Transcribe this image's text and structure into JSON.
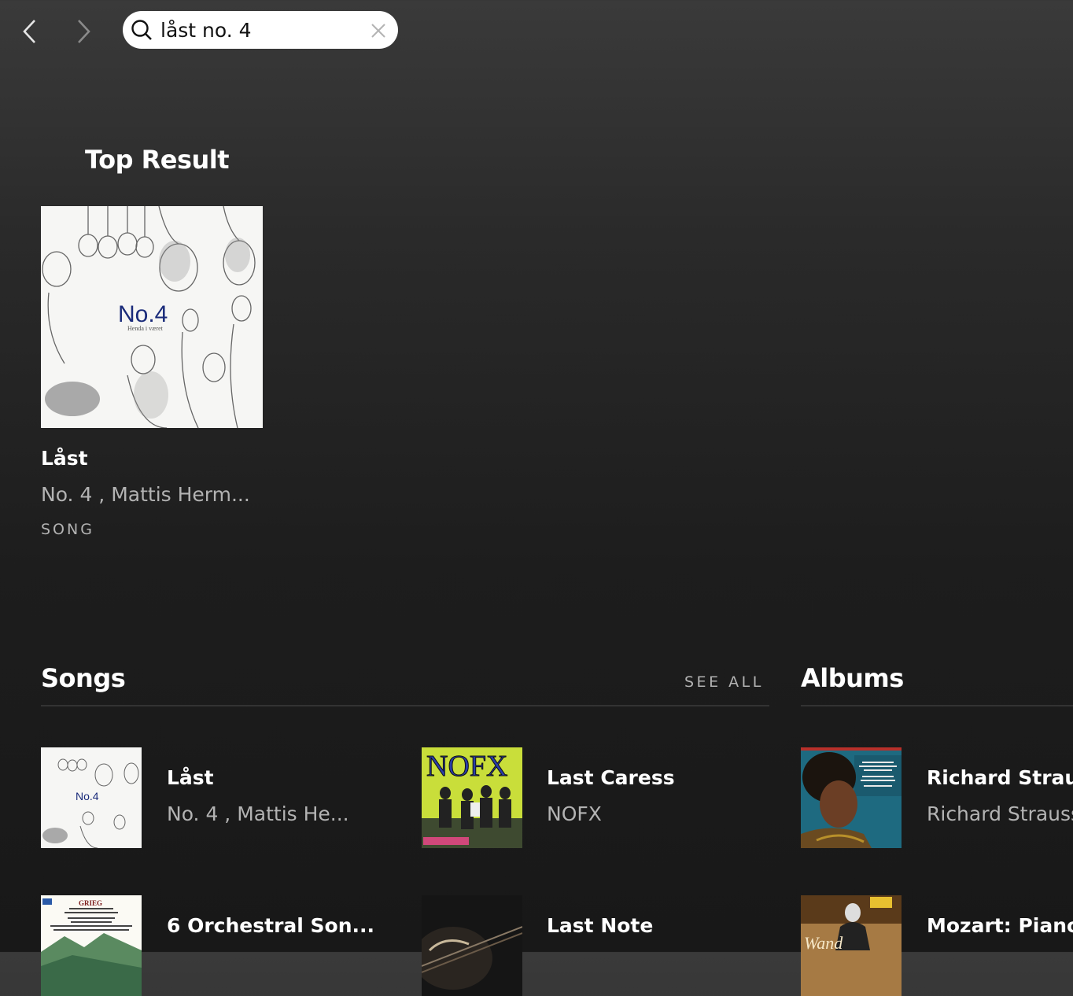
{
  "search": {
    "query": "låst no. 4"
  },
  "top_result": {
    "heading": "Top Result",
    "cover_text": "No.4",
    "cover_subtext": "Henda i været",
    "title": "Låst",
    "subtitle": "No. 4 , Mattis Herm...",
    "type": "SONG"
  },
  "songs": {
    "heading": "Songs",
    "see_all": "SEE ALL",
    "items": [
      {
        "title": "Låst",
        "subtitle": "No. 4 , Mattis He...",
        "cover": "No.4"
      },
      {
        "title": "Last Caress",
        "subtitle": "NOFX",
        "cover": "NOFX"
      },
      {
        "title": "6 Orchestral Son...",
        "subtitle": "",
        "cover": "GRIEG"
      },
      {
        "title": "Last Note",
        "subtitle": "",
        "cover": ""
      }
    ]
  },
  "albums": {
    "heading": "Albums",
    "items": [
      {
        "title": "Richard Strauss",
        "subtitle": "Richard Strauss"
      },
      {
        "title": "Mozart: Piano",
        "subtitle": ""
      }
    ]
  },
  "icons": [
    "chevron-left-icon",
    "chevron-right-icon",
    "search-icon",
    "close-icon"
  ],
  "colors": {
    "accent_text": "#ffffff",
    "muted_text": "#b3b3b3",
    "background": "#181818"
  }
}
